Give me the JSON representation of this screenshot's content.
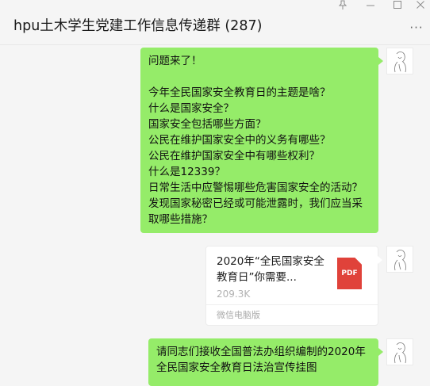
{
  "header": {
    "title": "hpu土木学生党建工作信息传递群 (287)",
    "pin_icon": "pin-icon",
    "minimize_icon": "minimize-icon",
    "maximize_icon": "maximize-icon",
    "close_icon": "close-icon",
    "more_icon": "more-icon"
  },
  "messages": [
    {
      "type": "text",
      "lines": [
        "问题来了！",
        "",
        "今年全民国家安全教育日的主题是啥？",
        "什么是国家安全？",
        "国家安全包括哪些方面？",
        "公民在维护国家安全中的义务有哪些？",
        "公民在维护国家安全中有哪些权利？",
        "什么是12339？",
        "日常生活中应警惕哪些危害国家安全的活动？",
        "发现国家秘密已经或可能泄露时，我们应当采",
        "取哪些措施？"
      ]
    },
    {
      "type": "file",
      "name": "2020年“全民国家安全教育日”你需要...",
      "size": "209.3K",
      "icon_label": "PDF",
      "source": "微信电脑版"
    },
    {
      "type": "text",
      "lines": [
        "请同志们接收全国普法办组织编制的2020年",
        "全民国家安全教育日法治宣传挂图"
      ]
    }
  ],
  "colors": {
    "background": "#f5f5f5",
    "self_bubble": "#95ec69",
    "file_card": "#ffffff",
    "pdf_icon": "#e0423a"
  }
}
